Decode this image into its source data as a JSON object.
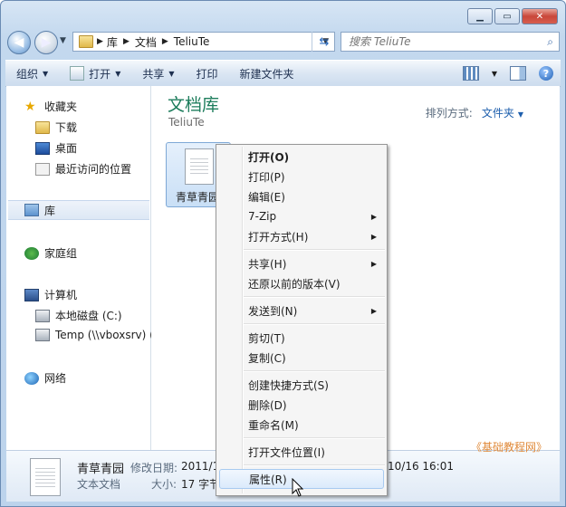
{
  "window": {
    "address": {
      "crumbs": [
        "库",
        "文档",
        "TeliuTe"
      ]
    },
    "search": {
      "placeholder": "搜索 TeliuTe"
    }
  },
  "toolbar": {
    "organize": "组织",
    "open": "打开",
    "share": "共享",
    "print": "打印",
    "new_folder": "新建文件夹"
  },
  "sidebar": {
    "favorites": "收藏夹",
    "downloads": "下载",
    "desktop": "桌面",
    "recent": "最近访问的位置",
    "libraries": "库",
    "homegroup": "家庭组",
    "computer": "计算机",
    "local_disk": "本地磁盘 (C:)",
    "temp_drive": "Temp (\\\\vboxsrv) (",
    "network": "网络"
  },
  "main": {
    "title": "文档库",
    "subtitle": "TeliuTe",
    "arrange_label": "排列方式:",
    "arrange_value": "文件夹",
    "file_name": "青草青园"
  },
  "context_menu": {
    "items": [
      {
        "label": "打开(O)"
      },
      {
        "label": "打印(P)"
      },
      {
        "label": "编辑(E)"
      },
      {
        "label": "7-Zip"
      },
      {
        "label": "打开方式(H)"
      },
      {
        "label": "共享(H)"
      },
      {
        "label": "还原以前的版本(V)"
      },
      {
        "label": "发送到(N)"
      },
      {
        "label": "剪切(T)"
      },
      {
        "label": "复制(C)"
      },
      {
        "label": "创建快捷方式(S)"
      },
      {
        "label": "删除(D)"
      },
      {
        "label": "重命名(M)"
      },
      {
        "label": "打开文件位置(I)"
      },
      {
        "label": "属性(R)"
      }
    ]
  },
  "details": {
    "name": "青草青园",
    "type": "文本文档",
    "modified_label": "修改日期:",
    "modified_value_left": "2011/1",
    "modified_value_right": "10/16 16:01",
    "size_label": "大小:",
    "size_value": "17 字节",
    "watermark": "《基础教程网》"
  }
}
